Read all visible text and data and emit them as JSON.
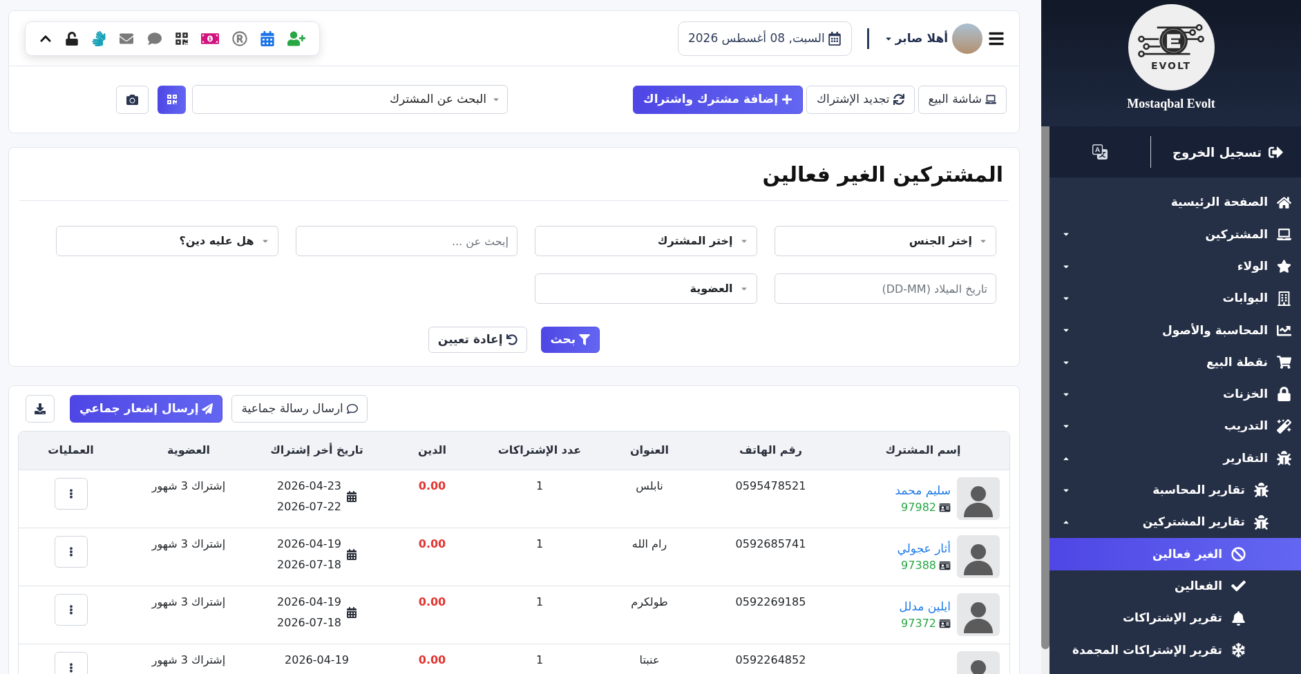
{
  "sidebar": {
    "logo_text": "EVOLT",
    "brand": "Mostaqbal Evolt",
    "logout": "تسجيل الخروج",
    "items": [
      {
        "label": "الصفحة الرئيسية",
        "kind": "link",
        "selected": false
      },
      {
        "label": "المشتركين",
        "kind": "group",
        "expanded": false,
        "selected": false
      },
      {
        "label": "الولاء",
        "kind": "group",
        "expanded": false,
        "selected": false
      },
      {
        "label": "البوابات",
        "kind": "group",
        "expanded": false,
        "selected": false
      },
      {
        "label": "المحاسبة والأصول",
        "kind": "group",
        "expanded": false,
        "selected": false
      },
      {
        "label": "نقطة البيع",
        "kind": "group",
        "expanded": false,
        "selected": false
      },
      {
        "label": "الخزنات",
        "kind": "group",
        "expanded": false,
        "selected": false
      },
      {
        "label": "التدريب",
        "kind": "group",
        "expanded": false,
        "selected": false
      },
      {
        "label": "التقارير",
        "kind": "group",
        "expanded": true,
        "selected": false,
        "children": [
          {
            "label": "تقارير المحاسبة",
            "kind": "group",
            "expanded": false,
            "selected": false
          },
          {
            "label": "تقارير المشتركين",
            "kind": "group",
            "expanded": true,
            "selected": false,
            "children": [
              {
                "label": "الغير فعالين",
                "kind": "link",
                "selected": true
              },
              {
                "label": "الفعالين",
                "kind": "link",
                "selected": false
              },
              {
                "label": "تقرير الإشتراكات",
                "kind": "link",
                "selected": false
              },
              {
                "label": "تقرير الإشتراكات المجمدة",
                "kind": "link",
                "selected": false
              }
            ]
          }
        ]
      }
    ]
  },
  "header": {
    "greeting": "أهلا صابر",
    "date": "السبت, 08 أغسطس 2026"
  },
  "actions": {
    "buttons": [
      {
        "kind": "outline",
        "label": "شاشة البيع"
      },
      {
        "kind": "outline",
        "label": "تجديد الإشتراك"
      },
      {
        "kind": "primary",
        "label": "إضافة مشترك واشتراك"
      }
    ],
    "search_select": {
      "value": "البحث عن المشترك"
    }
  },
  "page": {
    "title": "المشتركين الغير فعالين"
  },
  "filters": [
    {
      "kind": "select",
      "value": "إختر الجنس"
    },
    {
      "kind": "select",
      "value": "إختر المشترك"
    },
    {
      "kind": "input",
      "placeholder": "إبحث عن ..."
    },
    {
      "kind": "select",
      "value": "هل عليه دين؟"
    },
    {
      "kind": "input",
      "placeholder": "تاريخ الميلاد (DD-MM)"
    },
    {
      "kind": "select",
      "value": "العضوية"
    }
  ],
  "filter_buttons": [
    {
      "kind": "primary",
      "label": "بحث"
    },
    {
      "kind": "outline",
      "label": "إعادة تعيين"
    }
  ],
  "table_actions": [
    {
      "kind": "outline",
      "label": "ارسال رسالة جماعية"
    },
    {
      "kind": "primary",
      "label": "إرسال إشعار جماعي"
    },
    {
      "kind": "icon"
    }
  ],
  "table": {
    "columns": [
      "إسم المشترك",
      "رقم الهاتف",
      "العنوان",
      "عدد الإشتراكات",
      "الدين",
      "تاريخ أخر إشتراك",
      "العضوية",
      "العمليات"
    ],
    "rows": [
      {
        "name": "سليم محمد",
        "member_id": "97982",
        "phone": "0595478521",
        "address": "نابلس",
        "subscriptions": "1",
        "debt": "0.00",
        "dates": [
          "2026-04-23",
          "2026-07-22"
        ],
        "membership": "إشتراك 3 شهور"
      },
      {
        "name": "أثار عجولي",
        "member_id": "97388",
        "phone": "0592685741",
        "address": "رام الله",
        "subscriptions": "1",
        "debt": "0.00",
        "dates": [
          "2026-04-19",
          "2026-07-18"
        ],
        "membership": "إشتراك 3 شهور"
      },
      {
        "name": "ايلين مدلل",
        "member_id": "97372",
        "phone": "0592269185",
        "address": "طولكرم",
        "subscriptions": "1",
        "debt": "0.00",
        "dates": [
          "2026-04-19",
          "2026-07-18"
        ],
        "membership": "إشتراك 3 شهور"
      },
      {
        "phone": "0592264852",
        "address": "عنبتا",
        "subscriptions": "1",
        "debt": "0.00",
        "dates": [
          "2026-04-19"
        ],
        "membership": "إشتراك 3 شهور"
      }
    ]
  }
}
